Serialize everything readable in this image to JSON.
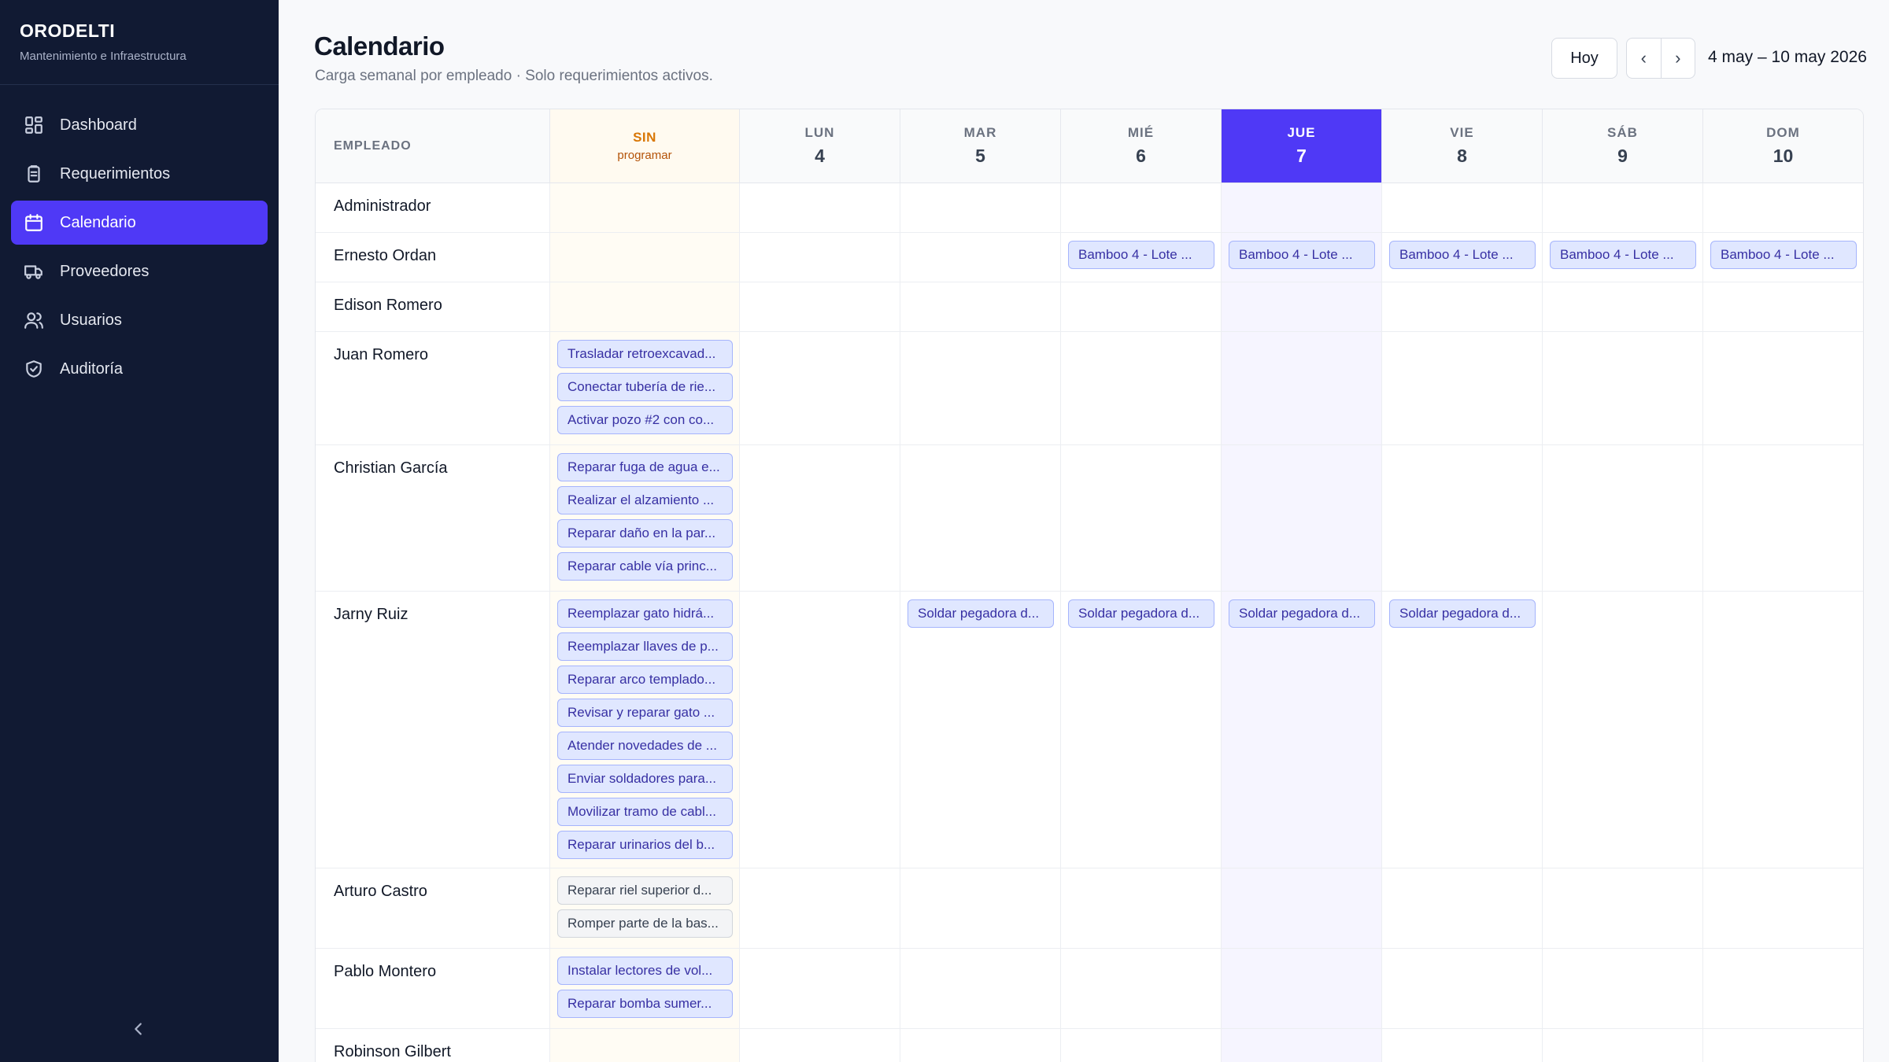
{
  "brand": {
    "name": "ORODELTI",
    "subtitle": "Mantenimiento e Infraestructura"
  },
  "sidebar": {
    "items": [
      {
        "label": "Dashboard",
        "icon": "dashboard-icon",
        "active": false
      },
      {
        "label": "Requerimientos",
        "icon": "clipboard-icon",
        "active": false
      },
      {
        "label": "Calendario",
        "icon": "calendar-icon",
        "active": true
      },
      {
        "label": "Proveedores",
        "icon": "truck-icon",
        "active": false
      },
      {
        "label": "Usuarios",
        "icon": "users-icon",
        "active": false
      },
      {
        "label": "Auditoría",
        "icon": "shield-check-icon",
        "active": false
      }
    ],
    "collapse_icon": "chevron-left-icon"
  },
  "header": {
    "title": "Calendario",
    "subtitle": "Carga semanal por empleado · Solo requerimientos activos.",
    "today_label": "Hoy",
    "prev_label": "‹",
    "next_label": "›",
    "range": "4 may – 10 may 2026"
  },
  "calendar": {
    "employee_header": "EMPLEADO",
    "unscheduled_header": {
      "top": "SIN",
      "bottom": "programar"
    },
    "days": [
      {
        "name": "LUN",
        "num": "4",
        "today": false
      },
      {
        "name": "MAR",
        "num": "5",
        "today": false
      },
      {
        "name": "MIÉ",
        "num": "6",
        "today": false
      },
      {
        "name": "JUE",
        "num": "7",
        "today": true
      },
      {
        "name": "VIE",
        "num": "8",
        "today": false
      },
      {
        "name": "SÁB",
        "num": "9",
        "today": false
      },
      {
        "name": "DOM",
        "num": "10",
        "today": false
      }
    ],
    "rows": [
      {
        "name": "Administrador",
        "unscheduled": [],
        "days": [
          [],
          [],
          [],
          [],
          [],
          [],
          []
        ]
      },
      {
        "name": "Ernesto Ordan",
        "unscheduled": [],
        "days": [
          [],
          [],
          [
            {
              "label": "Bamboo 4 - Lote ..."
            }
          ],
          [
            {
              "label": "Bamboo 4 - Lote ..."
            }
          ],
          [
            {
              "label": "Bamboo 4 - Lote ..."
            }
          ],
          [
            {
              "label": "Bamboo 4 - Lote ..."
            }
          ],
          [
            {
              "label": "Bamboo 4 - Lote ..."
            }
          ]
        ]
      },
      {
        "name": "Edison Romero",
        "unscheduled": [],
        "days": [
          [],
          [],
          [],
          [],
          [],
          [],
          []
        ]
      },
      {
        "name": "Juan Romero",
        "unscheduled": [
          {
            "label": "Trasladar retroexcavad...",
            "style": "blue"
          },
          {
            "label": "Conectar tubería de rie...",
            "style": "blue"
          },
          {
            "label": "Activar pozo #2 con co...",
            "style": "blue"
          }
        ],
        "days": [
          [],
          [],
          [],
          [],
          [],
          [],
          []
        ]
      },
      {
        "name": "Christian García",
        "unscheduled": [
          {
            "label": "Reparar fuga de agua e...",
            "style": "blue"
          },
          {
            "label": "Realizar el alzamiento ...",
            "style": "blue"
          },
          {
            "label": "Reparar daño en la par...",
            "style": "blue"
          },
          {
            "label": "Reparar cable vía princ...",
            "style": "blue"
          }
        ],
        "days": [
          [],
          [],
          [],
          [],
          [],
          [],
          []
        ]
      },
      {
        "name": "Jarny Ruiz",
        "unscheduled": [
          {
            "label": "Reemplazar gato hidrá...",
            "style": "blue"
          },
          {
            "label": "Reemplazar llaves de p...",
            "style": "blue"
          },
          {
            "label": "Reparar arco templado...",
            "style": "blue"
          },
          {
            "label": "Revisar y reparar gato ...",
            "style": "blue"
          },
          {
            "label": "Atender novedades de ...",
            "style": "blue"
          },
          {
            "label": "Enviar soldadores para...",
            "style": "blue"
          },
          {
            "label": "Movilizar tramo de cabl...",
            "style": "blue"
          },
          {
            "label": "Reparar urinarios del b...",
            "style": "blue"
          }
        ],
        "days": [
          [],
          [
            {
              "label": "Soldar pegadora d..."
            }
          ],
          [
            {
              "label": "Soldar pegadora d..."
            }
          ],
          [
            {
              "label": "Soldar pegadora d..."
            }
          ],
          [
            {
              "label": "Soldar pegadora d..."
            }
          ],
          [],
          []
        ]
      },
      {
        "name": "Arturo Castro",
        "unscheduled": [
          {
            "label": "Reparar riel superior d...",
            "style": "gray"
          },
          {
            "label": "Romper parte de la bas...",
            "style": "gray"
          }
        ],
        "days": [
          [],
          [],
          [],
          [],
          [],
          [],
          []
        ]
      },
      {
        "name": "Pablo Montero",
        "unscheduled": [
          {
            "label": "Instalar lectores de vol...",
            "style": "blue"
          },
          {
            "label": "Reparar bomba sumer...",
            "style": "blue"
          }
        ],
        "days": [
          [],
          [],
          [],
          [],
          [],
          [],
          []
        ]
      },
      {
        "name": "Robinson Gilbert",
        "unscheduled": [],
        "days": [
          [],
          [],
          [],
          [],
          [],
          [],
          []
        ]
      }
    ]
  },
  "colors": {
    "accent": "#4f39f6",
    "sidebar_bg": "#111a33",
    "chip_blue_bg": "#e0e7ff",
    "chip_gray_bg": "#f3f4f6",
    "unscheduled_header": "#d97706"
  }
}
